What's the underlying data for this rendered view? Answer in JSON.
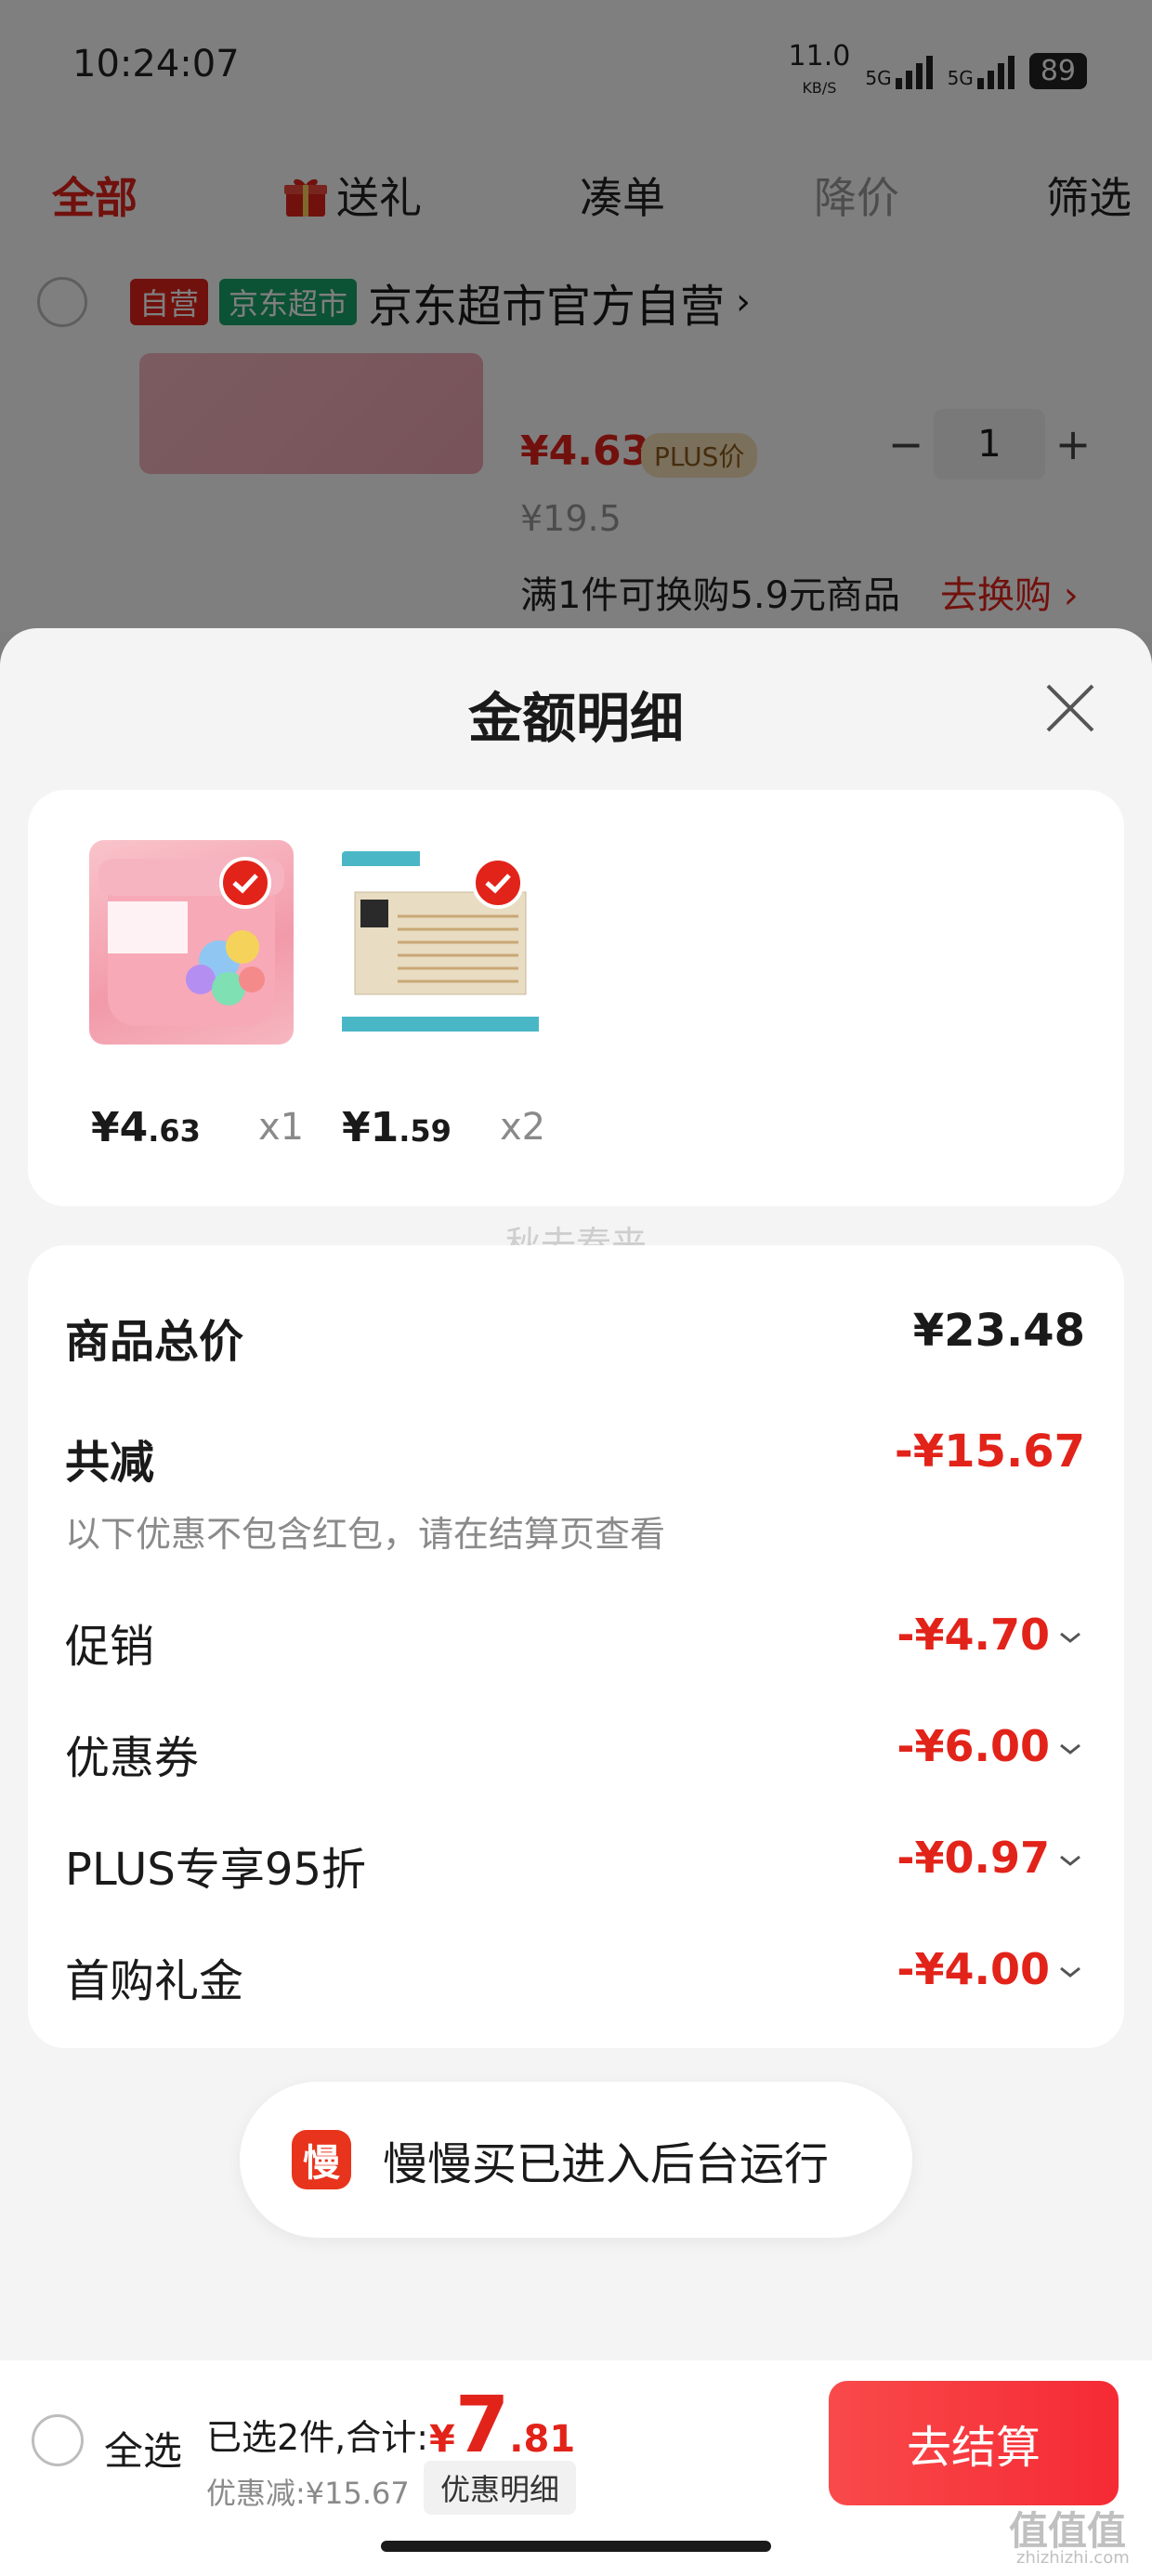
{
  "status_bar": {
    "time": "10:24:07",
    "net_speed": "11.0",
    "net_unit": "KB/S",
    "signal1": "5G",
    "signal2": "5G",
    "battery": "89"
  },
  "top_tabs": [
    {
      "label": "全部"
    },
    {
      "label": "送礼"
    },
    {
      "label": "凑单"
    },
    {
      "label": "降价"
    },
    {
      "label": "筛选"
    }
  ],
  "shop": {
    "badge_self": "自营",
    "badge_market": "京东超市",
    "name": "京东超市官方自营",
    "chevron": "›"
  },
  "background_product": {
    "price": "¥4.63",
    "plus_tag": "PLUS价",
    "qty": "1",
    "minus": "−",
    "plus": "+",
    "orig_price": "¥19.5",
    "exchange_text": "满1件可换购5.9元商品",
    "exchange_link": "去换购 ›"
  },
  "sheet": {
    "title": "金额明细"
  },
  "items": [
    {
      "price_int": "¥4",
      "price_dec": ".63",
      "qty": "x1",
      "icon": "checkmark-icon"
    },
    {
      "price_int": "¥1",
      "price_dec": ".59",
      "qty": "x2",
      "icon": "checkmark-icon"
    }
  ],
  "watermark": "秋去春来",
  "summary": {
    "total_label": "商品总价",
    "total_value": "¥23.48",
    "reduce_label": "共减",
    "reduce_value": "-¥15.67",
    "note": "以下优惠不包含红包，请在结算页查看",
    "rows": [
      {
        "label": "促销",
        "value": "-¥4.70"
      },
      {
        "label": "优惠券",
        "value": "-¥6.00"
      },
      {
        "label": "PLUS专享95折",
        "value": "-¥0.97"
      },
      {
        "label": "首购礼金",
        "value": "-¥4.00"
      }
    ]
  },
  "toast": {
    "icon_char": "慢",
    "text": "慢慢买已进入后台运行"
  },
  "bottom": {
    "select_all": "全选",
    "selected": "已选2件,合计:",
    "total_currency": "¥",
    "total_int": "7",
    "total_dec": ".81",
    "saved": "优惠减:¥15.67",
    "detail_button": "优惠明细",
    "checkout": "去结算"
  },
  "site_mark": "值值值",
  "site_url": "zhizhizhi.com",
  "colors": {
    "accent_red": "#e2231a",
    "badge_green": "#19a56b",
    "checkout": "#f52a34"
  }
}
